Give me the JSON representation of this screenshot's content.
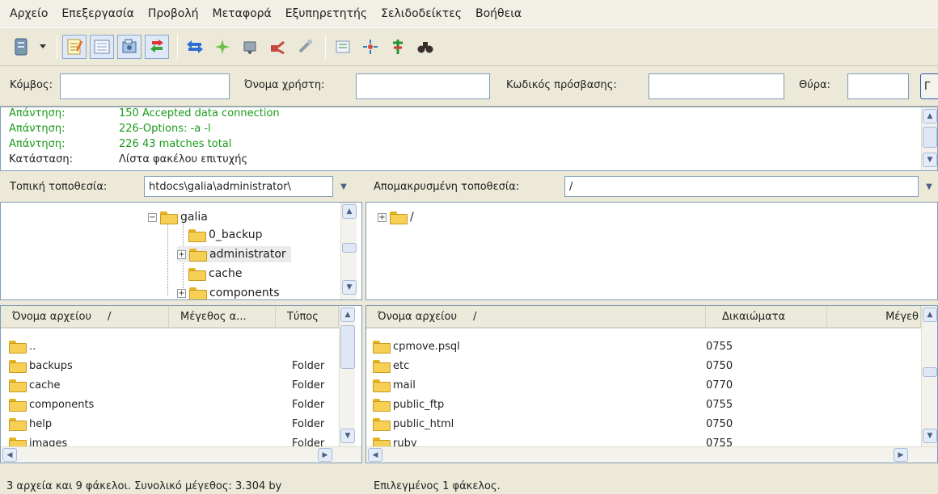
{
  "menu": [
    "Αρχείο",
    "Επεξεργασία",
    "Προβολή",
    "Μεταφορά",
    "Εξυπηρετητής",
    "Σελιδοδείκτες",
    "Βοήθεια"
  ],
  "quickconnect": {
    "host_label": "Κόμβος:",
    "user_label": "Όνομα χρήστη:",
    "password_label": "Κωδικός πρόσβασης:",
    "port_label": "Θύρα:",
    "connect_label": "Γ"
  },
  "log": [
    {
      "key": "Απάντηση:",
      "value": "150 Accepted data connection",
      "color": "#1a9a1a"
    },
    {
      "key": "Απάντηση:",
      "value": "226-Options: -a -l",
      "color": "#1a9a1a"
    },
    {
      "key": "Απάντηση:",
      "value": "226 43 matches total",
      "color": "#1a9a1a"
    },
    {
      "key": "Κατάσταση:",
      "value": "Λίστα φακέλου επιτυχής",
      "color": "#222222"
    }
  ],
  "local": {
    "label": "Τοπική τοποθεσία:",
    "path": "htdocs\\galia\\administrator\\",
    "tree": [
      "galia",
      "0_backup",
      "administrator",
      "cache",
      "components"
    ],
    "headers": [
      "Όνομα αρχείου",
      "Μέγεθος α...",
      "Τύπος"
    ],
    "files": [
      {
        "name": "..",
        "type": ""
      },
      {
        "name": "backups",
        "type": "Folder"
      },
      {
        "name": "cache",
        "type": "Folder"
      },
      {
        "name": "components",
        "type": "Folder"
      },
      {
        "name": "help",
        "type": "Folder"
      },
      {
        "name": "images",
        "type": "Folder"
      }
    ],
    "status": "3 αρχεία και 9 φάκελοι. Συνολικό μέγεθος: 3.304 by"
  },
  "remote": {
    "label": "Απομακρυσμένη τοποθεσία:",
    "path": "/",
    "tree_root": "/",
    "headers": [
      "Όνομα αρχείου",
      "Δικαιώματα",
      "Μέγεθ"
    ],
    "files": [
      {
        "name": "cpmove.psql",
        "perm": "0755"
      },
      {
        "name": "etc",
        "perm": "0750"
      },
      {
        "name": "mail",
        "perm": "0770"
      },
      {
        "name": "public_ftp",
        "perm": "0755"
      },
      {
        "name": "public_html",
        "perm": "0750"
      },
      {
        "name": "ruby",
        "perm": "0755"
      }
    ],
    "status": "Επιλεγμένος 1 φάκελος."
  },
  "icons": {
    "site-manager": "server-icon",
    "log-toggle": "notepad-icon",
    "tree-toggle": "tree-icon",
    "remote-tree": "folders-icon",
    "queue": "transfer-icon",
    "refresh": "refresh-icon",
    "process-queue": "process-icon",
    "cancel": "cancel-icon",
    "disconnect": "disconnect-icon",
    "reconnect": "reconnect-icon",
    "filter": "filter-icon",
    "compare": "compare-icon",
    "sync": "sync-icon",
    "search": "binoculars-icon"
  }
}
